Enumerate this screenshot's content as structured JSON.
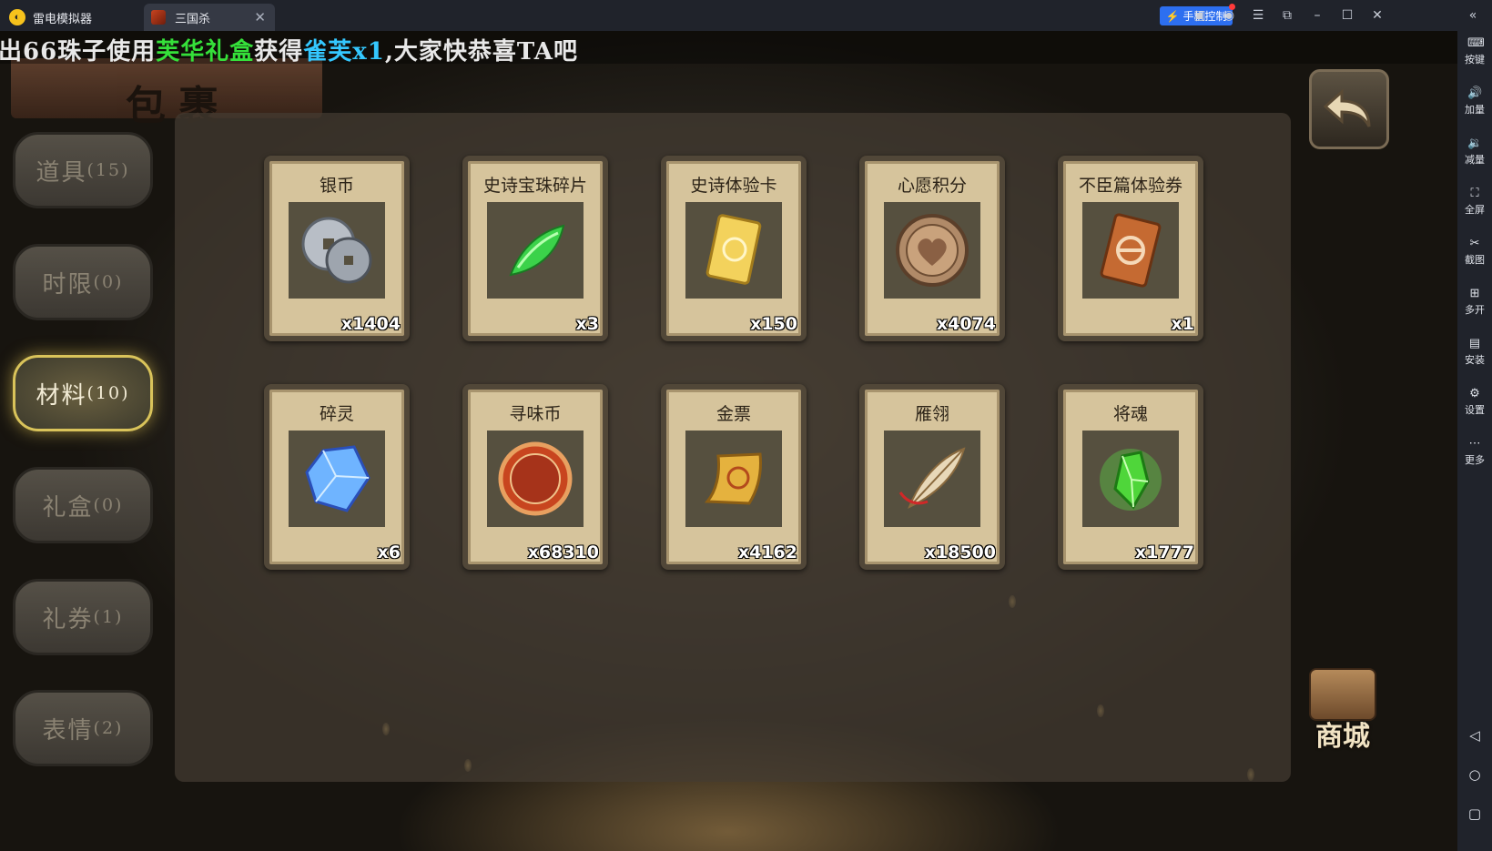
{
  "emulator": {
    "home_tab": "雷电模拟器",
    "game_tab": "三国杀",
    "phone_control": "手机控制",
    "sidebar": [
      {
        "label": "按键",
        "icon": "keyboard-icon"
      },
      {
        "label": "加量",
        "icon": "volume-up-icon"
      },
      {
        "label": "减量",
        "icon": "volume-down-icon"
      },
      {
        "label": "全屏",
        "icon": "fullscreen-icon"
      },
      {
        "label": "截图",
        "icon": "scissors-icon"
      },
      {
        "label": "多开",
        "icon": "multi-instance-icon"
      },
      {
        "label": "安装",
        "icon": "apk-install-icon"
      },
      {
        "label": "设置",
        "icon": "settings-icon"
      },
      {
        "label": "更多",
        "icon": "more-icon"
      }
    ]
  },
  "ticker": {
    "part1": "出66珠子使用",
    "item": "芙华礼盒",
    "part2": "获得",
    "reward": "雀芙x1",
    "part3": ",大家快恭喜TA吧"
  },
  "bag_title": "包裹",
  "categories": [
    {
      "label": "道具",
      "count": "(15)",
      "active": false
    },
    {
      "label": "时限",
      "count": "(0)",
      "active": false
    },
    {
      "label": "材料",
      "count": "(10)",
      "active": true
    },
    {
      "label": "礼盒",
      "count": "(0)",
      "active": false
    },
    {
      "label": "礼券",
      "count": "(1)",
      "active": false
    },
    {
      "label": "表情",
      "count": "(2)",
      "active": false
    }
  ],
  "items": [
    {
      "name": "银币",
      "qty": "x1404",
      "icon": "silver-coin-icon"
    },
    {
      "name": "史诗宝珠碎片",
      "qty": "x3",
      "icon": "green-gem-shard-icon"
    },
    {
      "name": "史诗体验卡",
      "qty": "x150",
      "icon": "gold-card-icon"
    },
    {
      "name": "心愿积分",
      "qty": "x4074",
      "icon": "heart-coin-icon"
    },
    {
      "name": "不臣篇体验券",
      "qty": "x1",
      "icon": "copper-ticket-icon"
    },
    {
      "name": "碎灵",
      "qty": "x6",
      "icon": "blue-crystal-icon"
    },
    {
      "name": "寻味币",
      "qty": "x68310",
      "icon": "red-flavor-coin-icon"
    },
    {
      "name": "金票",
      "qty": "x4162",
      "icon": "gold-scroll-icon"
    },
    {
      "name": "雁翎",
      "qty": "x18500",
      "icon": "feather-icon"
    },
    {
      "name": "将魂",
      "qty": "x1777",
      "icon": "green-soul-crystal-icon"
    }
  ],
  "shop_label": "商城",
  "colors": {
    "ticker_highlight_green": "#35e03a",
    "ticker_highlight_blue": "#34c8ff",
    "active_tab_glow": "#d9c35a",
    "phone_control_bg": "#2d6ff0"
  }
}
